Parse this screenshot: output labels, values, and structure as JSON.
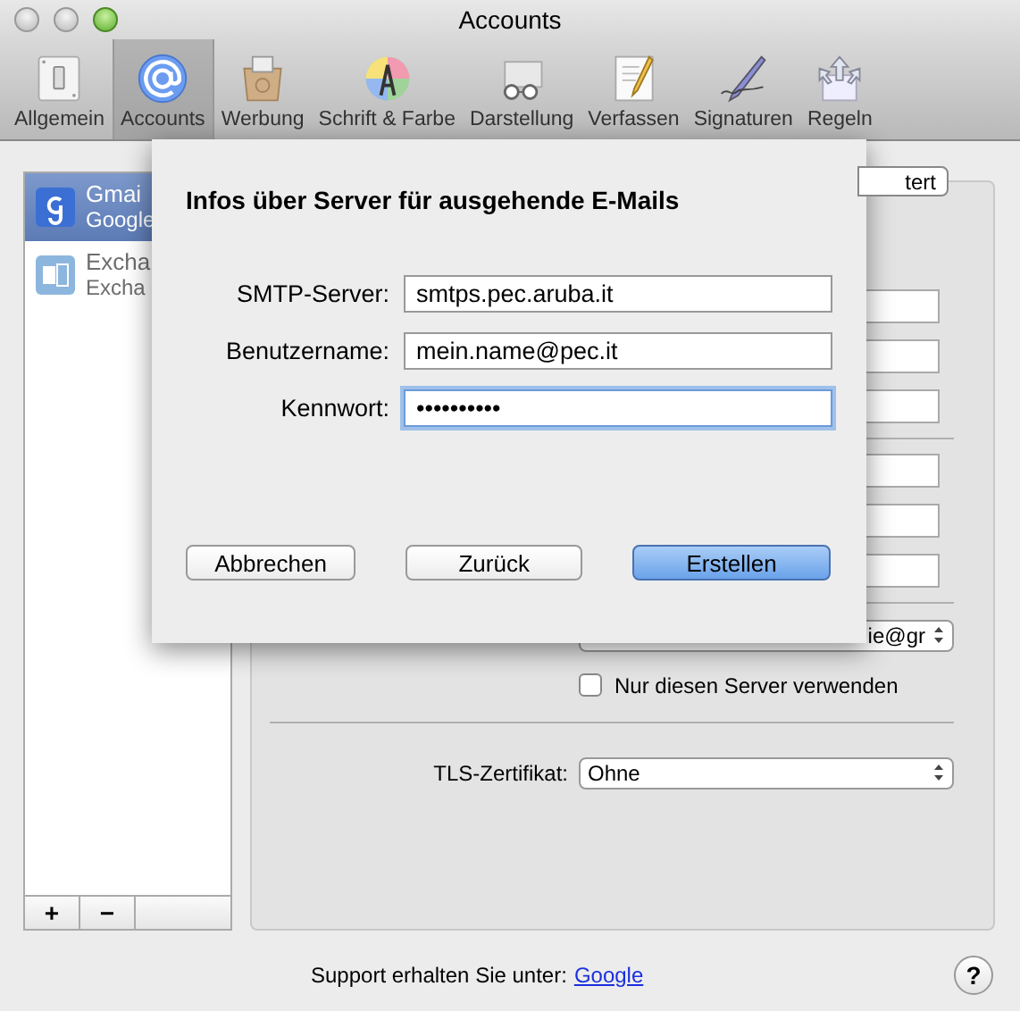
{
  "window": {
    "title": "Accounts"
  },
  "toolbar": [
    {
      "label": "Allgemein",
      "kind": "switch",
      "selected": false
    },
    {
      "label": "Accounts",
      "kind": "at",
      "selected": true
    },
    {
      "label": "Werbung",
      "kind": "package",
      "selected": false
    },
    {
      "label": "Schrift & Farbe",
      "kind": "colors",
      "selected": false
    },
    {
      "label": "Darstellung",
      "kind": "glasses",
      "selected": false
    },
    {
      "label": "Verfassen",
      "kind": "note",
      "selected": false
    },
    {
      "label": "Signaturen",
      "kind": "pen",
      "selected": false
    },
    {
      "label": "Regeln",
      "kind": "arrows",
      "selected": false
    }
  ],
  "accounts": [
    {
      "name": "Gmai",
      "type": "Google",
      "kind": "google",
      "selected": true
    },
    {
      "name": "Excha",
      "type": "Excha",
      "kind": "exchange",
      "selected": false
    }
  ],
  "list_buttons": [
    "+",
    "−"
  ],
  "pane": {
    "tab_fragment": "tert",
    "smtp_popup": "ie@gr",
    "only_server": {
      "label": "Nur diesen Server verwenden",
      "checked": false
    },
    "tls": {
      "label": "TLS-Zertifikat:",
      "value": "Ohne"
    }
  },
  "footer": {
    "text": "Support erhalten Sie unter:",
    "link": "Google"
  },
  "help": "?",
  "sheet": {
    "title": "Infos über Server für ausgehende E-Mails",
    "fields": [
      {
        "label": "SMTP-Server:",
        "value": "smtps.pec.aruba.it",
        "focused": false
      },
      {
        "label": "Benutzername:",
        "value": "mein.name@pec.it",
        "focused": false
      },
      {
        "label": "Kennwort:",
        "value": "••••••••••",
        "focused": true
      }
    ],
    "buttons": [
      {
        "label": "Abbrechen",
        "default": false
      },
      {
        "label": "Zurück",
        "default": false
      },
      {
        "label": "Erstellen",
        "default": true
      }
    ]
  }
}
